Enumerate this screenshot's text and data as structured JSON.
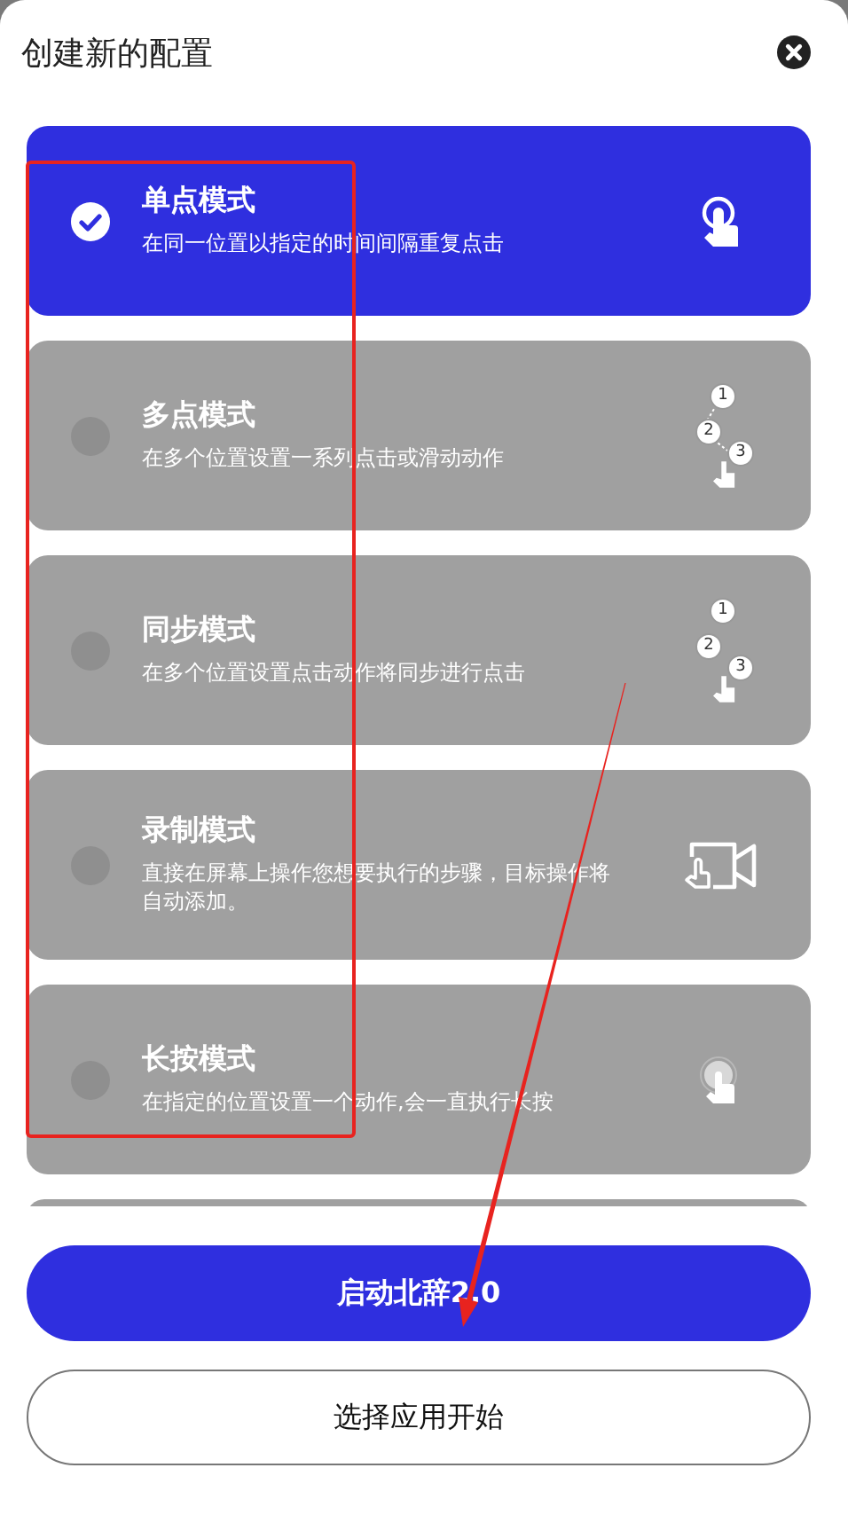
{
  "title": "创建新的配置",
  "modes": [
    {
      "title": "单点模式",
      "description": "在同一位置以指定的时间间隔重复点击",
      "selected": true,
      "kind": "tap"
    },
    {
      "title": "多点模式",
      "description": "在多个位置设置一系列点击或滑动动作",
      "selected": false,
      "kind": "sequence",
      "icon_labels": [
        "1",
        "2",
        "3"
      ]
    },
    {
      "title": "同步模式",
      "description": "在多个位置设置点击动作将同步进行点击",
      "selected": false,
      "kind": "sync",
      "icon_labels": [
        "1",
        "2",
        "3"
      ]
    },
    {
      "title": "录制模式",
      "description": "直接在屏幕上操作您想要执行的步骤，目标操作将自动添加。",
      "selected": false,
      "kind": "record"
    },
    {
      "title": "长按模式",
      "description": "在指定的位置设置一个动作,会一直执行长按",
      "selected": false,
      "kind": "long-press"
    }
  ],
  "primary_button": "启动北辞2.0",
  "secondary_button": "选择应用开始",
  "annotations": {
    "highlight_box": true,
    "arrow": true
  }
}
